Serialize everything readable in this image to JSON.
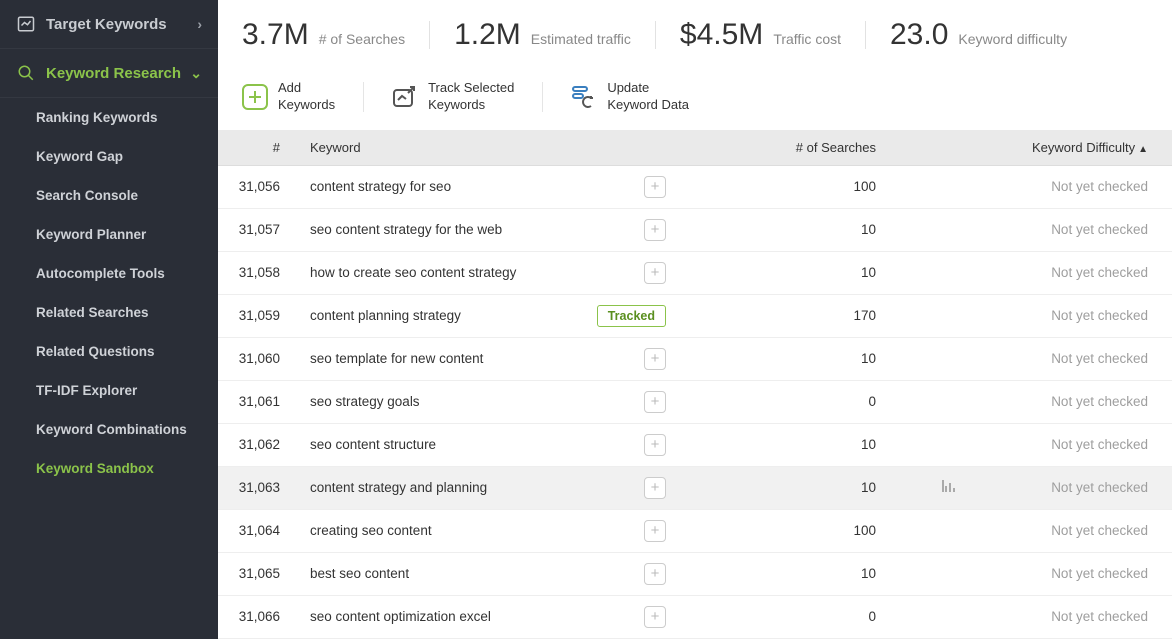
{
  "sidebar": {
    "sections": [
      {
        "label": "Target Keywords",
        "active": false,
        "chevron": "›"
      },
      {
        "label": "Keyword Research",
        "active": true,
        "chevron": "⌄"
      }
    ],
    "sub_items": [
      {
        "label": "Ranking Keywords",
        "active": false
      },
      {
        "label": "Keyword Gap",
        "active": false
      },
      {
        "label": "Search Console",
        "active": false
      },
      {
        "label": "Keyword Planner",
        "active": false
      },
      {
        "label": "Autocomplete Tools",
        "active": false
      },
      {
        "label": "Related Searches",
        "active": false
      },
      {
        "label": "Related Questions",
        "active": false
      },
      {
        "label": "TF-IDF Explorer",
        "active": false
      },
      {
        "label": "Keyword Combinations",
        "active": false
      },
      {
        "label": "Keyword Sandbox",
        "active": true
      }
    ]
  },
  "metrics": [
    {
      "value": "3.7M",
      "label": "# of Searches"
    },
    {
      "value": "1.2M",
      "label": "Estimated traffic"
    },
    {
      "value": "$4.5M",
      "label": "Traffic cost"
    },
    {
      "value": "23.0",
      "label": "Keyword difficulty"
    }
  ],
  "actions": [
    {
      "line1": "Add",
      "line2": "Keywords"
    },
    {
      "line1": "Track Selected",
      "line2": "Keywords"
    },
    {
      "line1": "Update",
      "line2": "Keyword Data"
    }
  ],
  "table": {
    "headers": {
      "num": "#",
      "keyword": "Keyword",
      "searches": "# of Searches",
      "difficulty": "Keyword Difficulty"
    },
    "rows": [
      {
        "num": "31,056",
        "keyword": "content strategy for seo",
        "tracked": false,
        "searches": "100",
        "difficulty": "Not yet checked",
        "hover": false
      },
      {
        "num": "31,057",
        "keyword": "seo content strategy for the web",
        "tracked": false,
        "searches": "10",
        "difficulty": "Not yet checked",
        "hover": false
      },
      {
        "num": "31,058",
        "keyword": "how to create seo content strategy",
        "tracked": false,
        "searches": "10",
        "difficulty": "Not yet checked",
        "hover": false
      },
      {
        "num": "31,059",
        "keyword": "content planning strategy",
        "tracked": true,
        "searches": "170",
        "difficulty": "Not yet checked",
        "hover": false
      },
      {
        "num": "31,060",
        "keyword": "seo template for new content",
        "tracked": false,
        "searches": "10",
        "difficulty": "Not yet checked",
        "hover": false
      },
      {
        "num": "31,061",
        "keyword": "seo strategy goals",
        "tracked": false,
        "searches": "0",
        "difficulty": "Not yet checked",
        "hover": false
      },
      {
        "num": "31,062",
        "keyword": "seo content structure",
        "tracked": false,
        "searches": "10",
        "difficulty": "Not yet checked",
        "hover": false
      },
      {
        "num": "31,063",
        "keyword": "content strategy and planning",
        "tracked": false,
        "searches": "10",
        "difficulty": "Not yet checked",
        "hover": true
      },
      {
        "num": "31,064",
        "keyword": "creating seo content",
        "tracked": false,
        "searches": "100",
        "difficulty": "Not yet checked",
        "hover": false
      },
      {
        "num": "31,065",
        "keyword": "best seo content",
        "tracked": false,
        "searches": "10",
        "difficulty": "Not yet checked",
        "hover": false
      },
      {
        "num": "31,066",
        "keyword": "seo content optimization excel",
        "tracked": false,
        "searches": "0",
        "difficulty": "Not yet checked",
        "hover": false
      }
    ],
    "tracked_label": "Tracked"
  }
}
